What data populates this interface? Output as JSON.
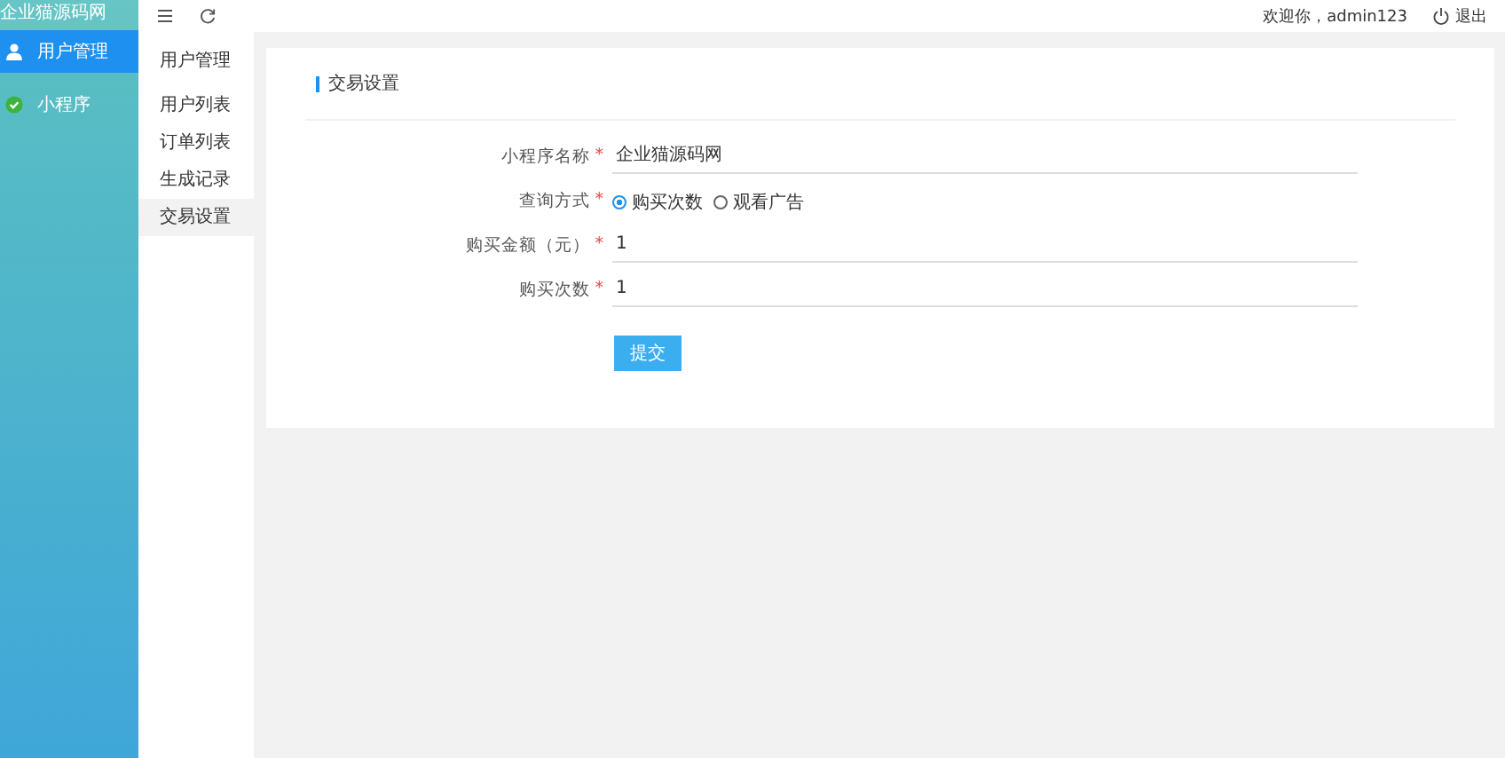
{
  "logo": "企业猫源码网",
  "nav": [
    {
      "label": "用户管理",
      "selected": true
    },
    {
      "label": "小程序",
      "selected": false
    }
  ],
  "subnav": {
    "title": "用户管理",
    "items": [
      {
        "label": "用户列表",
        "selected": false
      },
      {
        "label": "订单列表",
        "selected": false
      },
      {
        "label": "生成记录",
        "selected": false
      },
      {
        "label": "交易设置",
        "selected": true
      }
    ]
  },
  "topbar": {
    "greeting": "欢迎你，admin123",
    "logout": "退出"
  },
  "card": {
    "title": "交易设置",
    "fields": [
      {
        "kind": "text",
        "label": "小程序名称",
        "required_mark": "*",
        "value": "企业猫源码网"
      },
      {
        "kind": "radio",
        "label": "查询方式",
        "required_mark": "*",
        "options": [
          {
            "label": "购买次数",
            "selected": true
          },
          {
            "label": "观看广告",
            "selected": false
          }
        ]
      },
      {
        "kind": "text",
        "label": "购买金额（元）",
        "required_mark": "*",
        "value": "1"
      },
      {
        "kind": "text",
        "label": "购买次数",
        "required_mark": "*",
        "value": "1"
      }
    ],
    "submit": "提交"
  }
}
